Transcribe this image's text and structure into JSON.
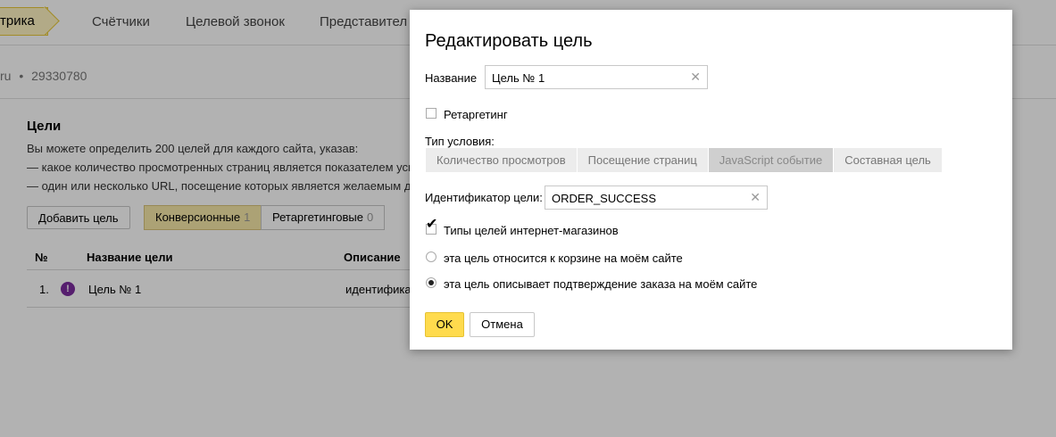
{
  "nav": {
    "brand": "трика",
    "tabs": [
      "Счётчики",
      "Целевой звонок",
      "Представител"
    ]
  },
  "breadcrumb": {
    "site": "ru",
    "separator": "•",
    "counter_id": "29330780"
  },
  "goals": {
    "title": "Цели",
    "desc_lines": [
      "Вы можете определить 200 целей для каждого сайта, указав:",
      "— какое количество просмотренных страниц является показателем усп",
      "— один или несколько URL, посещение которых является желаемым д"
    ],
    "add_button": "Добавить цель",
    "segments": [
      {
        "label": "Конверсионные",
        "count": "1"
      },
      {
        "label": "Ретаргетинговые",
        "count": "0"
      }
    ],
    "table": {
      "headers": [
        "№",
        "Название цели",
        "Описание"
      ],
      "rows": [
        {
          "num": "1.",
          "icon": "!",
          "name": "Цель № 1",
          "desc": "идентифика"
        }
      ]
    }
  },
  "modal": {
    "title": "Редактировать цель",
    "name_label": "Название",
    "name_value": "Цель № 1",
    "retargeting_label": "Ретаргетинг",
    "condition_label": "Тип условия:",
    "condition_tabs": [
      "Количество просмотров",
      "Посещение страниц",
      "JavaScript событие",
      "Составная цель"
    ],
    "active_tab_index": 2,
    "id_label": "Идентификатор цели:",
    "id_value": "ORDER_SUCCESS",
    "shop_types_label": "Типы целей интернет-магазинов",
    "radio_options": [
      "эта цель относится к корзине на моём сайте",
      "эта цель описывает подтверждение заказа на моём сайте"
    ],
    "selected_radio": 1,
    "ok_label": "OK",
    "cancel_label": "Отмена",
    "clear_glyph": "✕"
  },
  "colors": {
    "accent": "#ffdb4d",
    "goal_icon": "#7b2b9e",
    "overlay": "rgba(0,0,0,0.3)"
  },
  "icons": [
    "clear-icon",
    "checkmark-icon",
    "goal-status-icon"
  ]
}
